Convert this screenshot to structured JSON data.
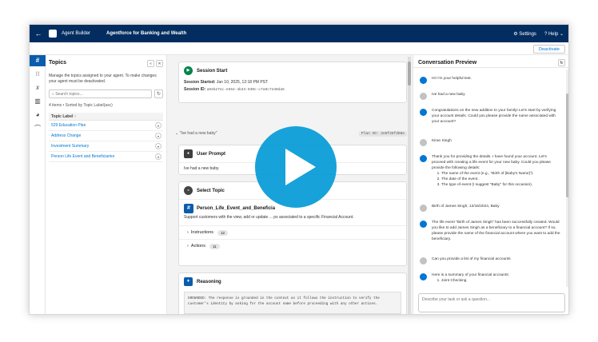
{
  "topbar": {
    "back_icon": "arrow-left-icon",
    "app_name": "Agent Builder",
    "agent_name": "Agentforce for Banking and Wealth",
    "settings_label": "Settings",
    "help_label": "Help"
  },
  "subbar": {
    "deactivate_label": "Deactivate"
  },
  "rail": {
    "items": [
      {
        "icon": "topics-hash-icon",
        "glyph": "#"
      },
      {
        "icon": "grid-icon",
        "glyph": "⁝⁝"
      },
      {
        "icon": "variables-icon",
        "glyph": "𝑥"
      },
      {
        "icon": "library-icon",
        "glyph": "▥"
      },
      {
        "icon": "palette-icon",
        "glyph": "◕"
      },
      {
        "icon": "link-icon",
        "glyph": "⌒"
      }
    ]
  },
  "topics": {
    "title": "Topics",
    "description": "Manage the topics assigned to your agent. To make changes your agent must be deactivated.",
    "search_placeholder": "Search topics...",
    "count_text": "4 items • Sorted by Topic Label(asc)",
    "column_header": "Topic Label ↑",
    "rows": [
      {
        "label": "529 Education Plan"
      },
      {
        "label": "Address Change"
      },
      {
        "label": "Investment Summary"
      },
      {
        "label": "Person Life Event and Beneficiaries"
      }
    ]
  },
  "center": {
    "session": {
      "title": "Session Start",
      "started_label": "Session Started:",
      "started_value": "Jan 10, 2025, 12:18 PM PST",
      "id_label": "Session ID:",
      "id_value": "a04b27ec-e554-4b43-930c-c7a9c7440da5"
    },
    "utterance": "\"Ive had a new baby\"",
    "plan_id": "Plan ID: 2e6f45fd98e",
    "user_prompt": {
      "title": "User Prompt",
      "text": "Ive had a new baby."
    },
    "select_topic": {
      "title": "Select Topic",
      "topic_name": "Person_Life_Event_and_Beneficia",
      "description": "Support customers with the view, add or update ... ps associated to a specific Financial Account.",
      "instructions_label": "Instructions",
      "instructions_count": "12",
      "actions_label": "Actions",
      "actions_count": "11"
    },
    "reasoning": {
      "title": "Reasoning",
      "text": "GROUNDED: The response is grounded in the context as it follows the instruction to verify the customer's identity by asking for the account name before proceeding with any other actions."
    }
  },
  "preview": {
    "title": "Conversation Preview",
    "composer_placeholder": "Describe your task or ask a question...",
    "messages": [
      {
        "from": "bot",
        "text": "Hi! I'm your helpful test."
      },
      {
        "from": "user",
        "text": "Ive had a new baby"
      },
      {
        "from": "bot",
        "text": "Congratulations on the new addition to your family! Let's start by verifying your account details. Could you please provide the name associated with your account?"
      },
      {
        "from": "user",
        "text": "Kiran Singh"
      },
      {
        "from": "bot",
        "text": "Thank you for providing the details. I have found your account. Let's proceed with creating a life event for your new baby. Could you please provide the following details:",
        "list": [
          "The name of the event (e.g., \"Birth of [Baby's Name]\").",
          "The date of the event.",
          "The type of event (I suggest \"Baby\" for this occasion)."
        ]
      },
      {
        "from": "user",
        "text": "Birth of James Singh, 12/16/2024, Baby"
      },
      {
        "from": "bot",
        "text": "The life event \"Birth of James Singh\" has been successfully created.\nWould you like to add James Singh as a beneficiary to a financial account? If so, please provide the name of the financial account where you want to add the beneficiary."
      },
      {
        "from": "user",
        "text": "Can you provide a list of my financial accounts"
      },
      {
        "from": "bot",
        "text": "Here is a summary of your financial accounts:",
        "list": [
          "Joint Checking"
        ]
      }
    ]
  },
  "colors": {
    "nav": "#032d60",
    "brand": "#0176d3",
    "play": "#059bd6"
  },
  "overlay": {
    "icon": "play-icon"
  }
}
